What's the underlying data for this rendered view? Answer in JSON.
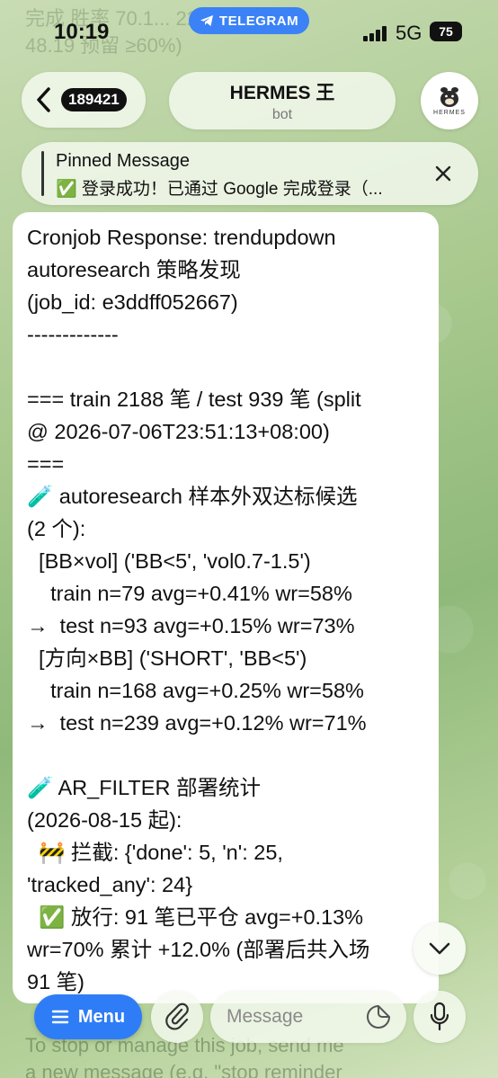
{
  "ghost_top": [
    "完成 胜率 70.1... 22 ...",
    "48.19 预留 ≥60%)",
    "",
    "To stop or manage this job, send me"
  ],
  "ghost_bottom": [
    "To stop or manage this job, send me",
    "a new message (e.g. \"stop reminder"
  ],
  "status_bar": {
    "time": "10:19",
    "telegram_label": "TELEGRAM",
    "network": "5G",
    "battery": "75"
  },
  "header": {
    "back_count": "189421",
    "title": "HERMES 王",
    "subtitle": "bot",
    "avatar_text": "HERMES"
  },
  "pinned": {
    "label": "Pinned Message",
    "text": "✅ 登录成功！已通过 Google 完成登录（..."
  },
  "message": {
    "lines": [
      "Cronjob Response: trendupdown",
      "autoresearch 策略发现",
      "(job_id: e3ddff052667)",
      "-------------",
      "",
      "=== train 2188 笔 / test 939 笔 (split",
      "@ 2026-07-06T23:51:13+08:00)",
      "===",
      "🧪 autoresearch 样本外双达标候选",
      "(2 个):",
      "  [BB×vol] ('BB<5', 'vol0.7-1.5')",
      "    train n=79 avg=+0.41% wr=58%",
      "→  test n=93 avg=+0.15% wr=73%",
      "  [方向×BB] ('SHORT', 'BB<5')",
      "    train n=168 avg=+0.25% wr=58%",
      "→  test n=239 avg=+0.12% wr=71%",
      "",
      "🧪 AR_FILTER 部署统计",
      "(2026-08-15 起):",
      "  🚧 拦截: {'done': 5, 'n': 25,",
      "'tracked_any': 24}",
      "  ✅ 放行: 91 笔已平仓 avg=+0.13%",
      "wr=70% 累计 +12.0% (部署后共入场",
      "91 笔)"
    ]
  },
  "composer": {
    "menu_label": "Menu",
    "placeholder": "Message"
  },
  "colors": {
    "accent": "#2f7df6",
    "telegram_pill": "#3b82f6",
    "bubble": "#ffffff"
  },
  "icons": [
    "chevron-left-icon",
    "telegram-plane-icon",
    "close-icon",
    "chevron-down-icon",
    "menu-lines-icon",
    "paperclip-icon",
    "sticker-icon",
    "microphone-icon"
  ]
}
